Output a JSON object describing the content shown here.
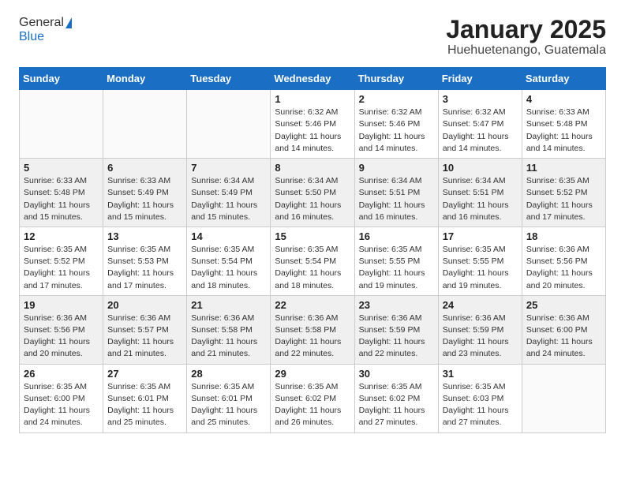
{
  "header": {
    "logo_general": "General",
    "logo_blue": "Blue",
    "month_title": "January 2025",
    "subtitle": "Huehuetenango, Guatemala"
  },
  "weekdays": [
    "Sunday",
    "Monday",
    "Tuesday",
    "Wednesday",
    "Thursday",
    "Friday",
    "Saturday"
  ],
  "weeks": [
    [
      {
        "day": "",
        "info": ""
      },
      {
        "day": "",
        "info": ""
      },
      {
        "day": "",
        "info": ""
      },
      {
        "day": "1",
        "info": "Sunrise: 6:32 AM\nSunset: 5:46 PM\nDaylight: 11 hours\nand 14 minutes."
      },
      {
        "day": "2",
        "info": "Sunrise: 6:32 AM\nSunset: 5:46 PM\nDaylight: 11 hours\nand 14 minutes."
      },
      {
        "day": "3",
        "info": "Sunrise: 6:32 AM\nSunset: 5:47 PM\nDaylight: 11 hours\nand 14 minutes."
      },
      {
        "day": "4",
        "info": "Sunrise: 6:33 AM\nSunset: 5:48 PM\nDaylight: 11 hours\nand 14 minutes."
      }
    ],
    [
      {
        "day": "5",
        "info": "Sunrise: 6:33 AM\nSunset: 5:48 PM\nDaylight: 11 hours\nand 15 minutes."
      },
      {
        "day": "6",
        "info": "Sunrise: 6:33 AM\nSunset: 5:49 PM\nDaylight: 11 hours\nand 15 minutes."
      },
      {
        "day": "7",
        "info": "Sunrise: 6:34 AM\nSunset: 5:49 PM\nDaylight: 11 hours\nand 15 minutes."
      },
      {
        "day": "8",
        "info": "Sunrise: 6:34 AM\nSunset: 5:50 PM\nDaylight: 11 hours\nand 16 minutes."
      },
      {
        "day": "9",
        "info": "Sunrise: 6:34 AM\nSunset: 5:51 PM\nDaylight: 11 hours\nand 16 minutes."
      },
      {
        "day": "10",
        "info": "Sunrise: 6:34 AM\nSunset: 5:51 PM\nDaylight: 11 hours\nand 16 minutes."
      },
      {
        "day": "11",
        "info": "Sunrise: 6:35 AM\nSunset: 5:52 PM\nDaylight: 11 hours\nand 17 minutes."
      }
    ],
    [
      {
        "day": "12",
        "info": "Sunrise: 6:35 AM\nSunset: 5:52 PM\nDaylight: 11 hours\nand 17 minutes."
      },
      {
        "day": "13",
        "info": "Sunrise: 6:35 AM\nSunset: 5:53 PM\nDaylight: 11 hours\nand 17 minutes."
      },
      {
        "day": "14",
        "info": "Sunrise: 6:35 AM\nSunset: 5:54 PM\nDaylight: 11 hours\nand 18 minutes."
      },
      {
        "day": "15",
        "info": "Sunrise: 6:35 AM\nSunset: 5:54 PM\nDaylight: 11 hours\nand 18 minutes."
      },
      {
        "day": "16",
        "info": "Sunrise: 6:35 AM\nSunset: 5:55 PM\nDaylight: 11 hours\nand 19 minutes."
      },
      {
        "day": "17",
        "info": "Sunrise: 6:35 AM\nSunset: 5:55 PM\nDaylight: 11 hours\nand 19 minutes."
      },
      {
        "day": "18",
        "info": "Sunrise: 6:36 AM\nSunset: 5:56 PM\nDaylight: 11 hours\nand 20 minutes."
      }
    ],
    [
      {
        "day": "19",
        "info": "Sunrise: 6:36 AM\nSunset: 5:56 PM\nDaylight: 11 hours\nand 20 minutes."
      },
      {
        "day": "20",
        "info": "Sunrise: 6:36 AM\nSunset: 5:57 PM\nDaylight: 11 hours\nand 21 minutes."
      },
      {
        "day": "21",
        "info": "Sunrise: 6:36 AM\nSunset: 5:58 PM\nDaylight: 11 hours\nand 21 minutes."
      },
      {
        "day": "22",
        "info": "Sunrise: 6:36 AM\nSunset: 5:58 PM\nDaylight: 11 hours\nand 22 minutes."
      },
      {
        "day": "23",
        "info": "Sunrise: 6:36 AM\nSunset: 5:59 PM\nDaylight: 11 hours\nand 22 minutes."
      },
      {
        "day": "24",
        "info": "Sunrise: 6:36 AM\nSunset: 5:59 PM\nDaylight: 11 hours\nand 23 minutes."
      },
      {
        "day": "25",
        "info": "Sunrise: 6:36 AM\nSunset: 6:00 PM\nDaylight: 11 hours\nand 24 minutes."
      }
    ],
    [
      {
        "day": "26",
        "info": "Sunrise: 6:35 AM\nSunset: 6:00 PM\nDaylight: 11 hours\nand 24 minutes."
      },
      {
        "day": "27",
        "info": "Sunrise: 6:35 AM\nSunset: 6:01 PM\nDaylight: 11 hours\nand 25 minutes."
      },
      {
        "day": "28",
        "info": "Sunrise: 6:35 AM\nSunset: 6:01 PM\nDaylight: 11 hours\nand 25 minutes."
      },
      {
        "day": "29",
        "info": "Sunrise: 6:35 AM\nSunset: 6:02 PM\nDaylight: 11 hours\nand 26 minutes."
      },
      {
        "day": "30",
        "info": "Sunrise: 6:35 AM\nSunset: 6:02 PM\nDaylight: 11 hours\nand 27 minutes."
      },
      {
        "day": "31",
        "info": "Sunrise: 6:35 AM\nSunset: 6:03 PM\nDaylight: 11 hours\nand 27 minutes."
      },
      {
        "day": "",
        "info": ""
      }
    ]
  ]
}
